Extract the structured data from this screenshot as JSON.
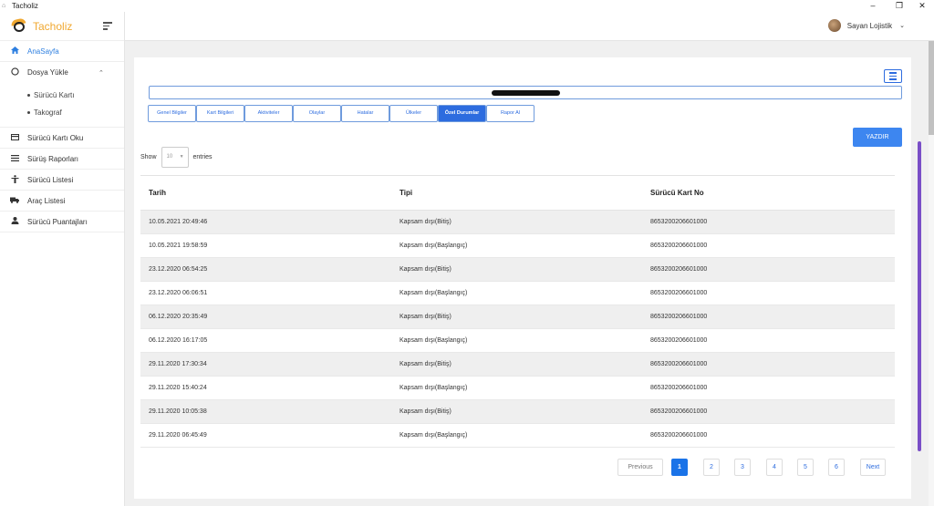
{
  "window": {
    "title": "Tacholiz",
    "controls": [
      "–",
      "❐",
      "✕"
    ]
  },
  "brand": {
    "name": "Tacholiz"
  },
  "user": {
    "name": "Sayan Lojistik"
  },
  "sidebar": {
    "items": [
      {
        "label": "AnaSayfa",
        "icon": "home-icon",
        "active": true
      },
      {
        "label": "Dosya Yükle",
        "icon": "circle-icon",
        "expanded": true
      },
      {
        "label": "Sürücü Kartı Oku",
        "icon": "card-icon"
      },
      {
        "label": "Sürüş Raporları",
        "icon": "list-icon"
      },
      {
        "label": "Sürücü Listesi",
        "icon": "person-icon"
      },
      {
        "label": "Araç Listesi",
        "icon": "truck-icon"
      },
      {
        "label": "Sürücü Puantajları",
        "icon": "user-icon"
      }
    ],
    "subitems": [
      {
        "label": "Sürücü Kartı"
      },
      {
        "label": "Takograf"
      }
    ]
  },
  "tabs": [
    {
      "label": "Genel Bilgiler"
    },
    {
      "label": "Kart Bilgileri"
    },
    {
      "label": "Aktiviteler"
    },
    {
      "label": "Olaylar"
    },
    {
      "label": "Hatalar"
    },
    {
      "label": "Ülkeler"
    },
    {
      "label": "Özel Durumlar",
      "active": true
    },
    {
      "label": "Rapor Al"
    }
  ],
  "actions": {
    "print": "YAZDIR"
  },
  "length_menu": {
    "show": "Show",
    "value": "10",
    "entries": "entries"
  },
  "table": {
    "columns": [
      "Tarih",
      "Tipi",
      "Sürücü Kart No"
    ],
    "rows": [
      [
        "10.05.2021 20:49:46",
        "Kapsam dışı(Bitiş)",
        "8653200206601000"
      ],
      [
        "10.05.2021 19:58:59",
        "Kapsam dışı(Başlangıç)",
        "8653200206601000"
      ],
      [
        "23.12.2020 06:54:25",
        "Kapsam dışı(Bitiş)",
        "8653200206601000"
      ],
      [
        "23.12.2020 06:06:51",
        "Kapsam dışı(Başlangıç)",
        "8653200206601000"
      ],
      [
        "06.12.2020 20:35:49",
        "Kapsam dışı(Bitiş)",
        "8653200206601000"
      ],
      [
        "06.12.2020 16:17:05",
        "Kapsam dışı(Başlangıç)",
        "8653200206601000"
      ],
      [
        "29.11.2020 17:30:34",
        "Kapsam dışı(Bitiş)",
        "8653200206601000"
      ],
      [
        "29.11.2020 15:40:24",
        "Kapsam dışı(Başlangıç)",
        "8653200206601000"
      ],
      [
        "29.11.2020 10:05:38",
        "Kapsam dışı(Bitiş)",
        "8653200206601000"
      ],
      [
        "29.11.2020 06:45:49",
        "Kapsam dışı(Başlangıç)",
        "8653200206601000"
      ]
    ]
  },
  "pagination": {
    "previous": "Previous",
    "next": "Next",
    "pages": [
      "1",
      "2",
      "3",
      "4",
      "5",
      "6"
    ],
    "current": "1"
  },
  "colors": {
    "primary": "#2d6cdf",
    "accent_bar": "#7a4fc7",
    "brand": "#f0a830"
  }
}
